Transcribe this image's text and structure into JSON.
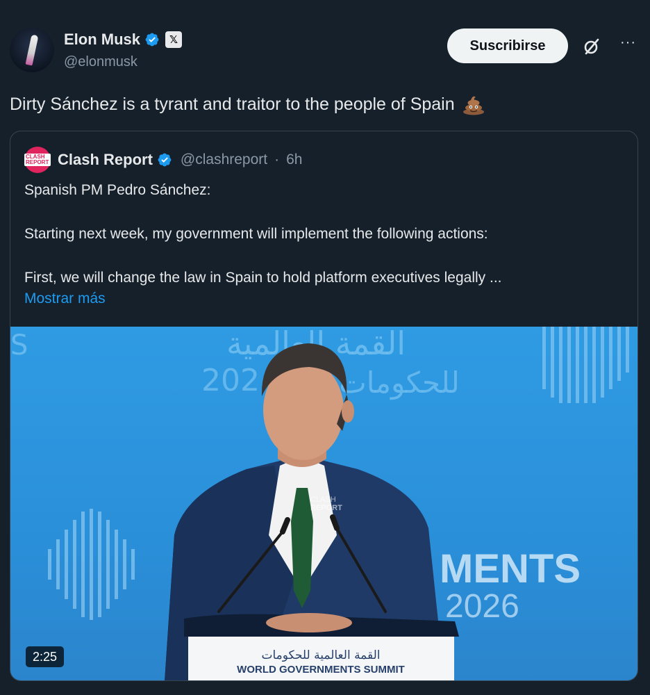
{
  "post": {
    "author_name": "Elon Musk",
    "author_handle": "@elonmusk",
    "x_badge": "𝕏",
    "subscribe_label": "Suscribirse",
    "more_label": "···",
    "text": "Dirty Sánchez is a tyrant and traitor to the people of Spain",
    "emoji_icon": "pile-of-poo-icon"
  },
  "quote": {
    "avatar_text": "CLASH REPORT",
    "name": "Clash Report",
    "handle": "@clashreport",
    "separator": "·",
    "time": "6h",
    "paragraphs": [
      "Spanish PM Pedro Sánchez:",
      "Starting next week, my government will implement the following actions:",
      "First, we will change the law in Spain to hold platform executives legally ..."
    ],
    "show_more": "Mostrar más",
    "video": {
      "duration": "2:25",
      "bg_arabic_top": "القمة العالمية",
      "bg_arabic_mid": "للحكومات",
      "bg_year_partial": "202",
      "bg_left_letter": "S",
      "bg_right_word": "MENTS",
      "bg_right_year": "2026",
      "watermark_line1": "CLASH",
      "watermark_line2": "REPORT",
      "podium_arabic": "القمة العالمية للحكومات",
      "podium_english": "WORLD GOVERNMENTS SUMMIT"
    }
  },
  "colors": {
    "background": "#15202b",
    "text": "#e7e9ea",
    "secondary_text": "#8b98a5",
    "link": "#1d9bf0",
    "verified": "#1d9bf0",
    "border": "#38444d",
    "stage_blue": "#2f9be3"
  }
}
